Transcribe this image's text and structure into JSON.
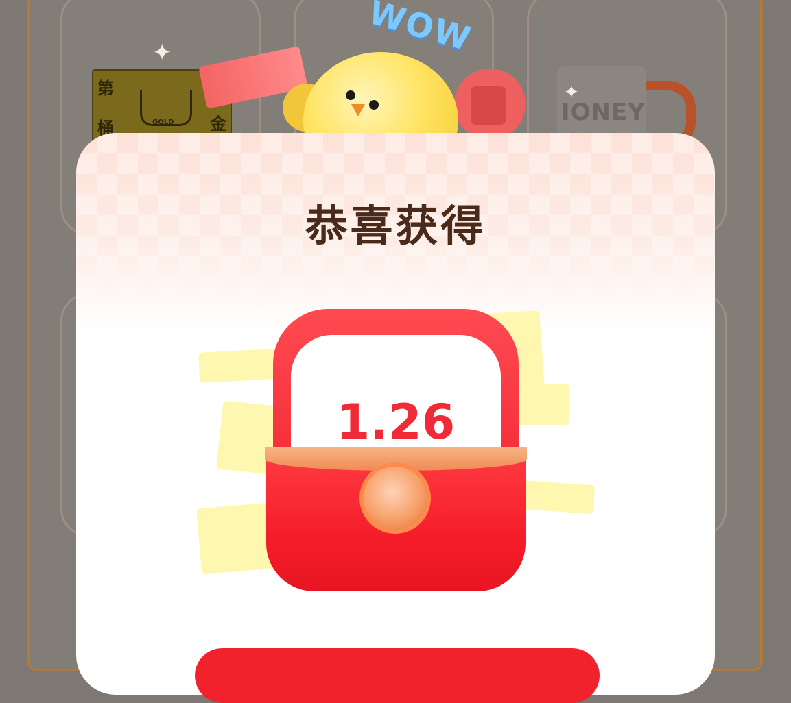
{
  "modal": {
    "title": "恭喜获得",
    "amount": "1.26"
  },
  "background": {
    "gold_card": {
      "chars": [
        "第",
        "桶",
        "金"
      ],
      "label": "GOLD"
    },
    "mug_text": "IONEY",
    "wow_text": "WOW"
  },
  "colors": {
    "accent": "#f02a36",
    "title": "#4a2a1a",
    "frame": "#b07a3a",
    "overlay": "#7d7874"
  }
}
